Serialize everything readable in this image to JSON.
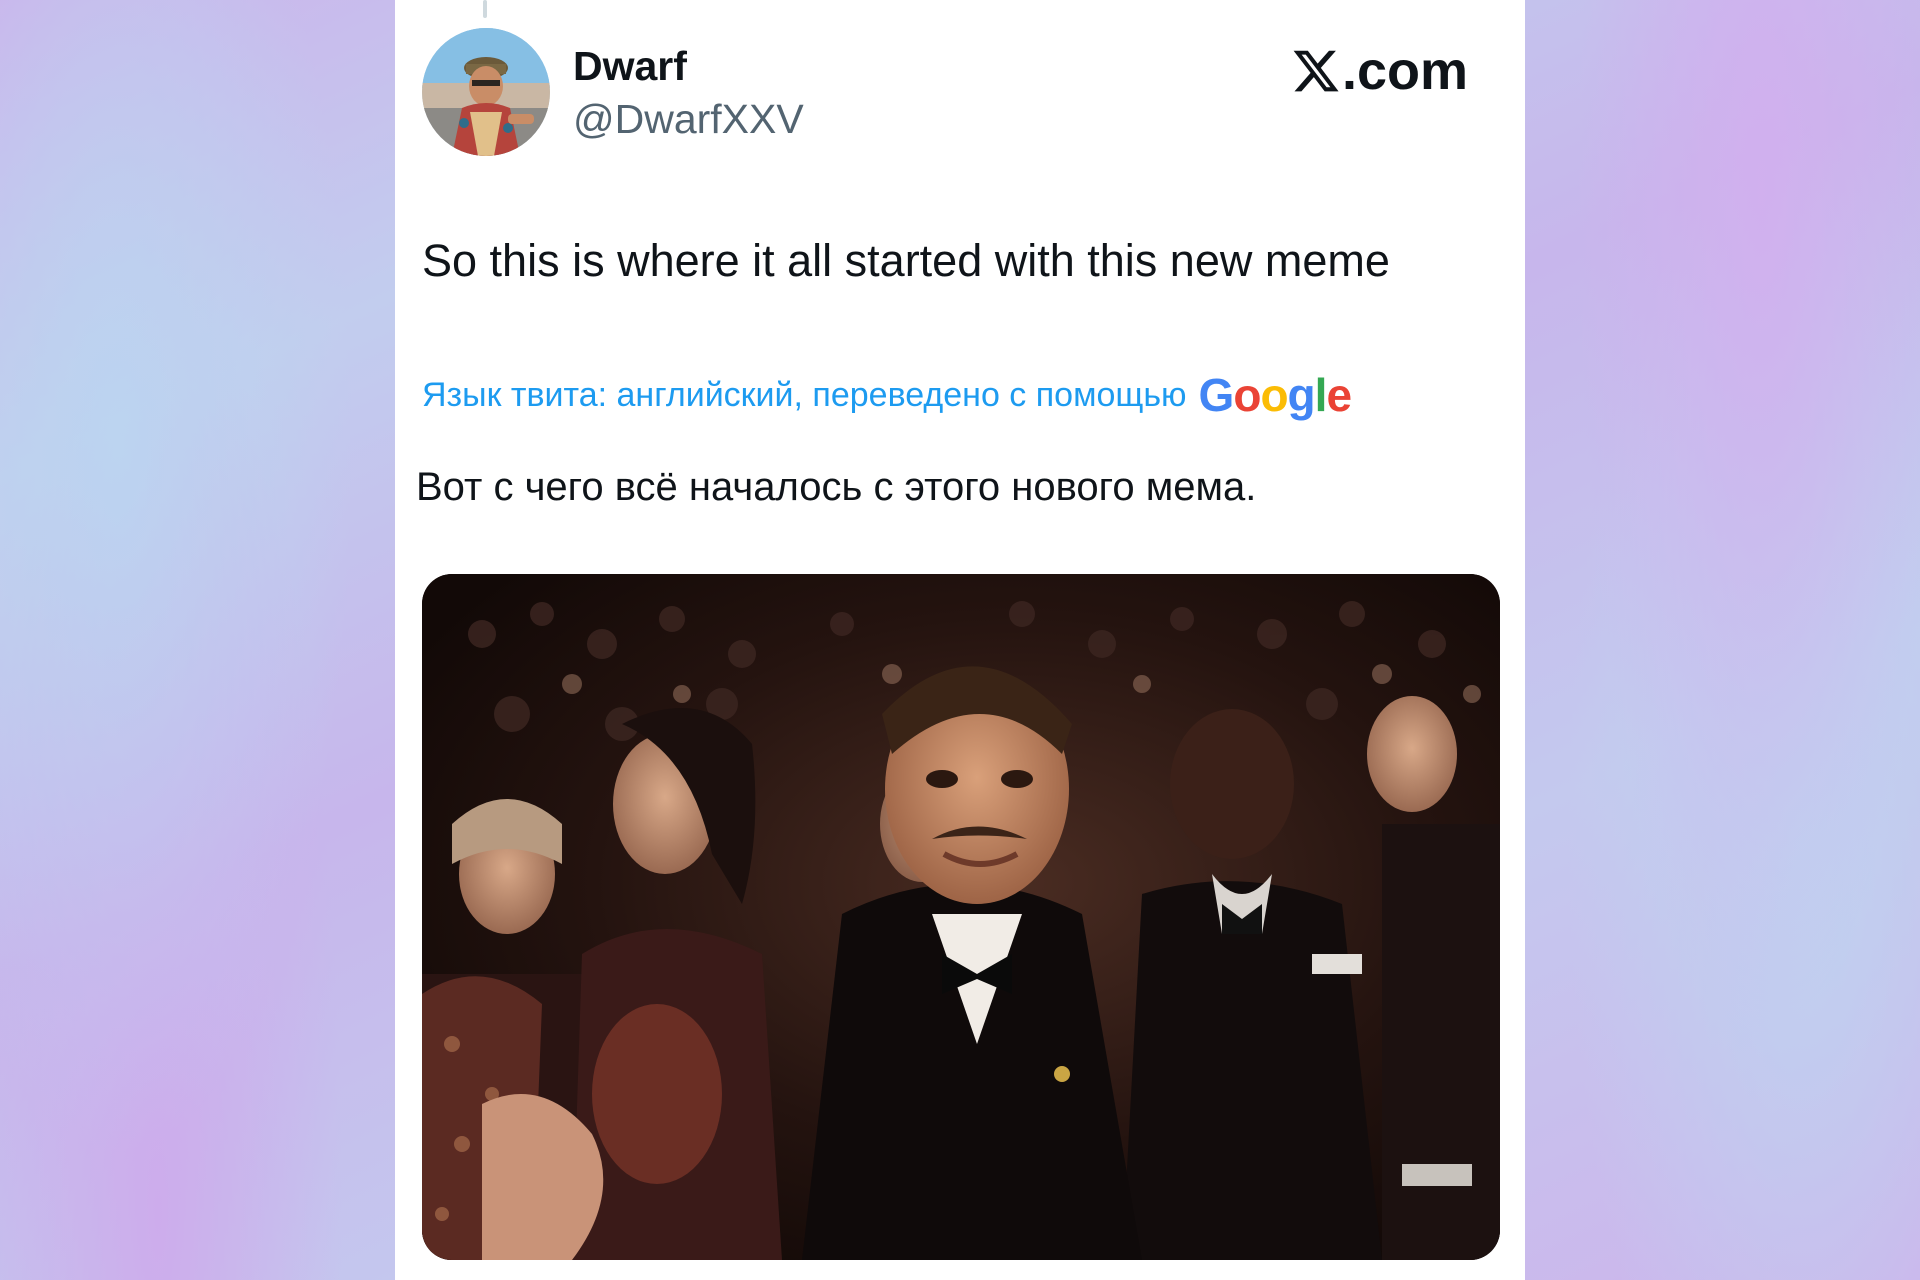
{
  "author": {
    "display_name": "Dwarf",
    "handle": "@DwarfXXV",
    "avatar": "avatar-photo"
  },
  "brand": {
    "icon": "x-logo-icon",
    "suffix": ".com"
  },
  "tweet": {
    "text": "So this is where it all started with this new meme",
    "translation_note": "Язык твита: английский, переведено с помощью",
    "translation_provider": [
      "G",
      "o",
      "o",
      "g",
      "l",
      "e"
    ],
    "translated_text": "Вот с чего всё началось с этого нового мема."
  },
  "media": {
    "type": "photo",
    "description_icon": "audience-photo"
  },
  "colors": {
    "link": "#1d9bf0",
    "text": "#0f1419",
    "secondary": "#536471"
  }
}
